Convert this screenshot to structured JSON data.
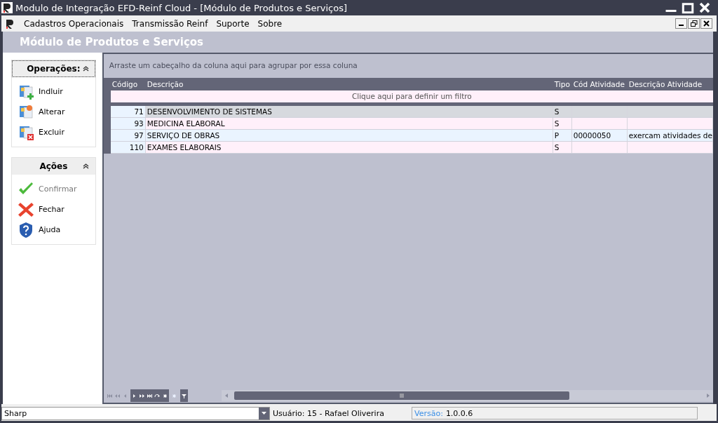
{
  "window": {
    "title": "Modulo de Integração EFD-Reinf Cloud - [Módulo de Produtos e Serviços]"
  },
  "menu": [
    {
      "label": "Cadastros Operacionais"
    },
    {
      "label": "Transmissão Reinf"
    },
    {
      "label": "Suporte"
    },
    {
      "label": "Sobre"
    }
  ],
  "page_title": "Módulo de Produtos e Serviços",
  "sidebar": [
    {
      "title": "Operações:",
      "expanded": true,
      "focused": true,
      "items": [
        {
          "label": "Indluir",
          "kind": "add",
          "disabled": false
        },
        {
          "label": "Alterar",
          "kind": "edit",
          "disabled": false
        },
        {
          "label": "Excluir",
          "kind": "delete",
          "disabled": false
        }
      ]
    },
    {
      "title": "Ações",
      "expanded": true,
      "focused": false,
      "items": [
        {
          "label": "Confirmar",
          "kind": "confirm",
          "disabled": true
        },
        {
          "label": "Fechar",
          "kind": "close",
          "disabled": false
        },
        {
          "label": "Ajuda",
          "kind": "help",
          "disabled": false
        }
      ]
    }
  ],
  "grid": {
    "group_hint": "Arraste um cabeçalho da coluna aqui para agrupar por essa coluna",
    "filter_hint": "Clique aqui para definir um filtro",
    "columns": [
      "Código",
      "Descrição",
      "Tipo",
      "Cód Atividade",
      "Descrição Atividade"
    ],
    "rows": [
      {
        "selected": true,
        "cells": [
          "71",
          "DESENVOLVIMENTO DE SISTEMAS",
          "S",
          "",
          ""
        ]
      },
      {
        "selected": false,
        "cells": [
          "93",
          "MEDICINA ELABORAL",
          "S",
          "",
          ""
        ]
      },
      {
        "selected": false,
        "cells": [
          "97",
          "SERVIÇO DE OBRAS",
          "P",
          "00000050",
          "exercam atividades de"
        ]
      },
      {
        "selected": false,
        "cells": [
          "110",
          "EXAMES ELABORAIS",
          "S",
          "",
          ""
        ]
      }
    ]
  },
  "status_bar": {
    "company": "Sharp",
    "user": "Usuário: 15 - Rafael Oliverira",
    "version_label": "Versão:",
    "version": "1.0.0.6"
  }
}
